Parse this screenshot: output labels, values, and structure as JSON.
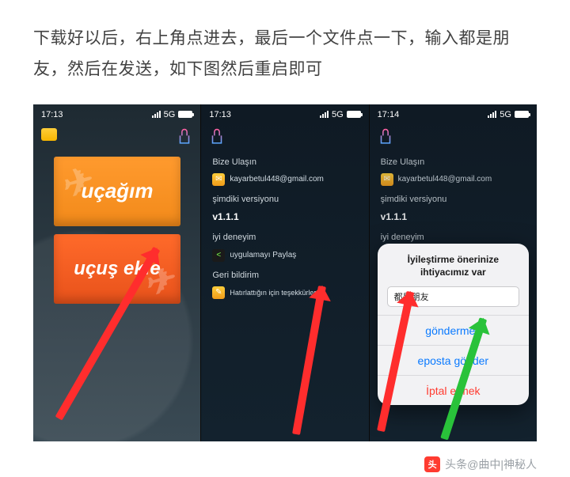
{
  "instruction": "下载好以后，右上角点进去，最后一个文件点一下，输入都是朋友，然后在发送，如下图然后重启即可",
  "status": {
    "time1": "17:13",
    "time2": "17:13",
    "time3": "17:14",
    "net": "5G"
  },
  "pane1": {
    "card1": "uçağım",
    "card2": "uçuş ekle"
  },
  "settings": {
    "contact_title": "Bize Ulaşın",
    "email": "kayarbetul448@gmail.com",
    "version_title": "şimdiki versiyonu",
    "version": "v1.1.1",
    "experience_title": "iyi deneyim",
    "share": "uygulamayı Paylaş",
    "feedback_title": "Geri bildirim",
    "thanks": "Hatırlattığın için teşekkürler"
  },
  "dialog": {
    "title": "İyileştirme önerinize ihtiyacımız var",
    "input_value": "都是朋友",
    "send": "göndermek",
    "mail": "eposta gönder",
    "cancel": "İptal etmek"
  },
  "attribution": {
    "badge": "头",
    "label": "头条@曲中|神秘人"
  }
}
